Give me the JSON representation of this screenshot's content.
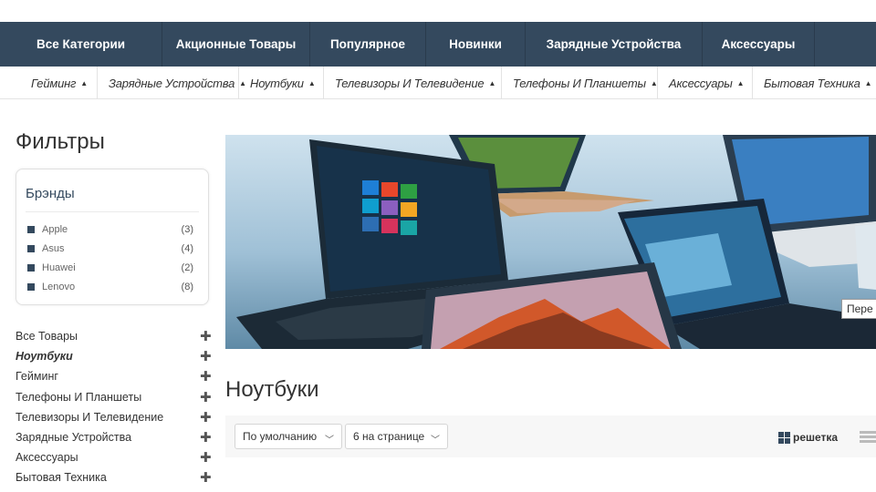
{
  "top_nav": {
    "items": [
      {
        "label": "Все Категории"
      },
      {
        "label": "Акционные Товары"
      },
      {
        "label": "Популярное"
      },
      {
        "label": "Новинки"
      },
      {
        "label": "Зарядные Устройства"
      },
      {
        "label": "Аксессуары"
      }
    ]
  },
  "sub_nav": {
    "items": [
      {
        "label": "Гейминг"
      },
      {
        "label": "Зарядные Устройства"
      },
      {
        "label": "Ноутбуки"
      },
      {
        "label": "Телевизоры И Телевидение"
      },
      {
        "label": "Телефоны И Планшеты"
      },
      {
        "label": "Аксессуары"
      },
      {
        "label": "Бытовая Техника"
      }
    ]
  },
  "sidebar": {
    "title": "Фильтры",
    "brands_title": "Брэнды",
    "brands": [
      {
        "name": "Apple",
        "count": "(3)"
      },
      {
        "name": "Asus",
        "count": "(4)"
      },
      {
        "name": "Huawei",
        "count": "(2)"
      },
      {
        "name": "Lenovo",
        "count": "(8)"
      }
    ],
    "categories": [
      {
        "label": "Все Товары"
      },
      {
        "label": "Ноутбуки",
        "active": true
      },
      {
        "label": "Гейминг"
      },
      {
        "label": "Телефоны И Планшеты"
      },
      {
        "label": "Телевизоры И Телевидение"
      },
      {
        "label": "Зарядные Устройства"
      },
      {
        "label": "Аксессуары"
      },
      {
        "label": "Бытовая Техника"
      }
    ]
  },
  "banner": {
    "tooltip": "Пере"
  },
  "main": {
    "title": "Ноутбуки",
    "sort_value": "По умолчанию",
    "per_page_value": "6 на странице",
    "grid_label": "решетка"
  },
  "colors": {
    "nav_bg": "#34495e",
    "accent": "#34495e"
  }
}
